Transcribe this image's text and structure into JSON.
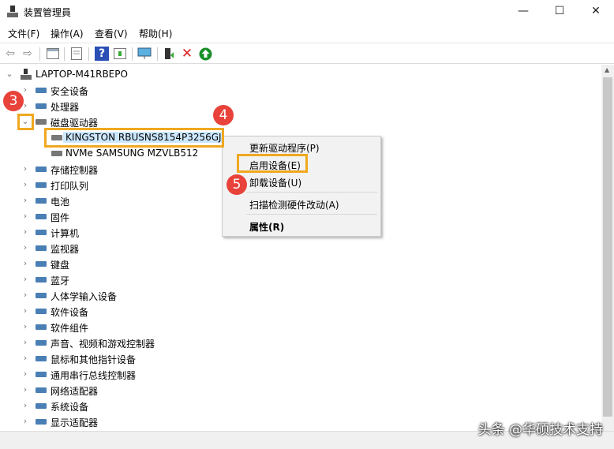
{
  "window": {
    "title": "装置管理員",
    "minimize": "—",
    "maximize": "☐",
    "close": "✕"
  },
  "menu": [
    "文件(F)",
    "操作(A)",
    "查看(V)",
    "帮助(H)"
  ],
  "toolbar": [
    "back-icon",
    "forward-icon",
    "show-hide-console-icon",
    "properties-icon",
    "help-icon",
    "action-pane-icon",
    "scan-hardware-icon",
    "update-driver-icon",
    "uninstall-icon",
    "enable-device-icon"
  ],
  "tree": {
    "root": "LAPTOP-M41RBEPO",
    "items": [
      {
        "label": "安全设备",
        "icon": "security-icon"
      },
      {
        "label": "处理器",
        "icon": "processor-icon"
      },
      {
        "label": "磁盘驱动器",
        "icon": "disk-icon",
        "expanded": true
      },
      {
        "label": "KINGSTON RBUSNS8154P3256GJ",
        "icon": "disabled-disk-icon",
        "child": true,
        "selected": true
      },
      {
        "label": "NVMe SAMSUNG MZVLB512",
        "icon": "disk-icon",
        "child": true
      },
      {
        "label": "存储控制器",
        "icon": "storage-icon"
      },
      {
        "label": "打印队列",
        "icon": "printer-icon"
      },
      {
        "label": "电池",
        "icon": "battery-icon"
      },
      {
        "label": "固件",
        "icon": "firmware-icon"
      },
      {
        "label": "计算机",
        "icon": "computer-icon"
      },
      {
        "label": "监视器",
        "icon": "monitor-icon"
      },
      {
        "label": "键盘",
        "icon": "keyboard-icon"
      },
      {
        "label": "蓝牙",
        "icon": "bluetooth-icon"
      },
      {
        "label": "人体学输入设备",
        "icon": "hid-icon"
      },
      {
        "label": "软件设备",
        "icon": "software-device-icon"
      },
      {
        "label": "软件组件",
        "icon": "software-component-icon"
      },
      {
        "label": "声音、视频和游戏控制器",
        "icon": "sound-icon"
      },
      {
        "label": "鼠标和其他指针设备",
        "icon": "mouse-icon"
      },
      {
        "label": "通用串行总线控制器",
        "icon": "usb-icon"
      },
      {
        "label": "网络适配器",
        "icon": "network-icon"
      },
      {
        "label": "系统设备",
        "icon": "system-icon"
      },
      {
        "label": "显示适配器",
        "icon": "display-icon"
      }
    ]
  },
  "context_menu": {
    "update": "更新驱动程序(P)",
    "enable": "启用设备(E)",
    "uninstall": "卸载设备(U)",
    "scan": "扫描检测硬件改动(A)",
    "properties": "属性(R)"
  },
  "badges": [
    "3",
    "4",
    "5"
  ],
  "watermark": "头条 @华硕技术支持",
  "colors": {
    "highlight": "#f0a820",
    "badge": "#e8423a",
    "selection": "#cce8ff"
  }
}
